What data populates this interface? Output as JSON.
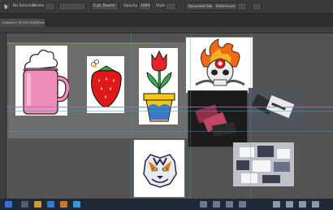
{
  "control_bar": {
    "selection_label": "No Selection",
    "stroke_label": "Stroke",
    "stroke_value": "",
    "uniform_label": "5 pt. Round",
    "opacity_label": "Opacity",
    "opacity_value": "100%",
    "style_label": "Style",
    "document_setup_label": "Document Setup",
    "preferences_label": "Preferences"
  },
  "document_tab": {
    "title": "Untitled-1* @ 19% (RGB/Preview)"
  },
  "artboards": [
    {
      "name": "pink-mug-artwork"
    },
    {
      "name": "strawberry-artwork"
    },
    {
      "name": "tulip-pot-artwork"
    },
    {
      "name": "flaming-skull-artwork"
    },
    {
      "name": "tiger-head-artwork"
    }
  ],
  "photos": [
    {
      "name": "business-card-photo-1"
    },
    {
      "name": "business-card-photo-2"
    },
    {
      "name": "brochure-photo"
    }
  ],
  "colors": {
    "chrome_dark": "#2e2e2e",
    "canvas": "#535353",
    "guide": "#38a7b0"
  }
}
